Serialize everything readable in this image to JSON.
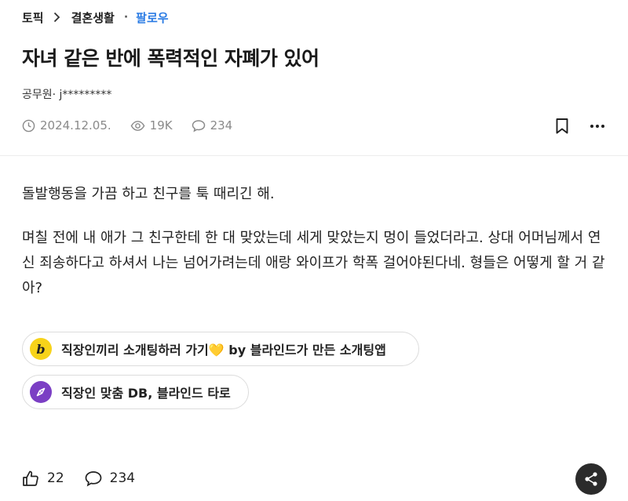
{
  "breadcrumb": {
    "topic": "토픽",
    "category": "결혼생활",
    "follow": "팔로우"
  },
  "post": {
    "title": "자녀 같은 반에 폭력적인 자폐가 있어",
    "author": "공무원· j*********",
    "date": "2024.12.05.",
    "views": "19K",
    "comments": "234",
    "paragraphs": [
      "돌발행동을 가끔 하고 친구를 툭 때리긴 해.",
      "며칠 전에 내 애가 그 친구한테 한 대 맞았는데 세게 맞았는지 멍이 들었더라고. 상대 어머님께서 연신 죄송하다고 하셔서 나는 넘어가려는데 애랑 와이프가 학폭 걸어야된다네. 형들은 어떻게 할 거 같아?"
    ]
  },
  "promos": [
    {
      "label": "직장인끼리 소개팅하러 가기💛 by 블라인드가 만든 소개팅앱",
      "badge": "b",
      "icon": "blind-b-icon"
    },
    {
      "label": "직장인 맞춤 DB, 블라인드 타로",
      "icon": "compass-icon"
    }
  ],
  "footer": {
    "likes": "22",
    "comments": "234"
  },
  "colors": {
    "accent": "#2a7be4",
    "promo_yellow": "#f7d31a",
    "promo_purple": "#7b3fc4",
    "share_bg": "#2b2b2b"
  }
}
